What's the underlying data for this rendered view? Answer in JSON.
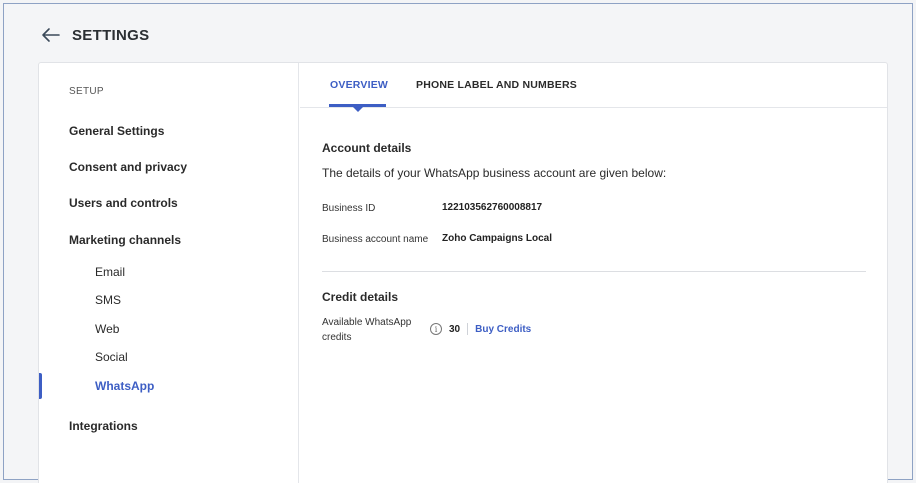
{
  "header": {
    "title": "SETTINGS"
  },
  "sidebar": {
    "heading": "SETUP",
    "items": [
      {
        "label": "General Settings"
      },
      {
        "label": "Consent and privacy"
      },
      {
        "label": "Users and controls"
      },
      {
        "label": "Marketing channels"
      },
      {
        "label": "Email"
      },
      {
        "label": "SMS"
      },
      {
        "label": "Web"
      },
      {
        "label": "Social"
      },
      {
        "label": "WhatsApp"
      },
      {
        "label": "Integrations"
      }
    ]
  },
  "tabs": [
    {
      "label": "OVERVIEW",
      "active": true
    },
    {
      "label": "PHONE LABEL AND NUMBERS",
      "active": false
    }
  ],
  "account": {
    "title": "Account details",
    "description": "The details of your WhatsApp business account are given below:",
    "business_id_label": "Business ID",
    "business_id_value": "122103562760008817",
    "business_name_label": "Business account name",
    "business_name_value": "Zoho Campaigns Local"
  },
  "credit": {
    "title": "Credit details",
    "available_label_line1": "Available WhatsApp",
    "available_label_line2": "credits",
    "info_glyph": "i",
    "count": "30",
    "buy_label": "Buy Credits"
  },
  "colors": {
    "accent": "#3d5ec4",
    "frame_border": "#8ea2c4"
  },
  "icons": {
    "back": "back-arrow-icon",
    "info": "info-icon"
  }
}
